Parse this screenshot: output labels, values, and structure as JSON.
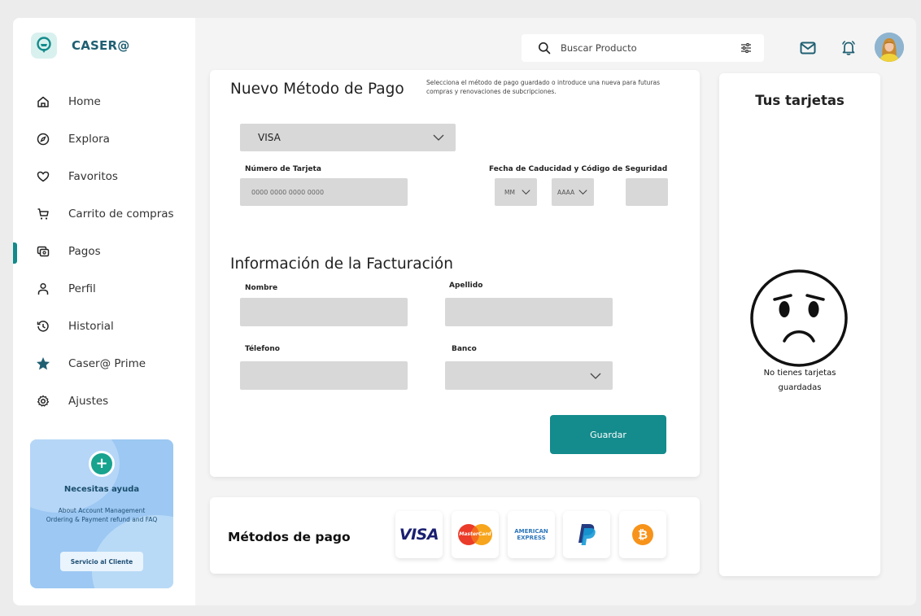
{
  "brand": {
    "name": "CASER@"
  },
  "nav": [
    {
      "label": "Home",
      "icon": "home-icon",
      "active": false
    },
    {
      "label": "Explora",
      "icon": "compass-icon",
      "active": false
    },
    {
      "label": "Favoritos",
      "icon": "heart-icon",
      "active": false
    },
    {
      "label": "Carrito de compras",
      "icon": "cart-icon",
      "active": false
    },
    {
      "label": "Pagos",
      "icon": "payments-icon",
      "active": true
    },
    {
      "label": "Perfil",
      "icon": "user-icon",
      "active": false
    },
    {
      "label": "Historial",
      "icon": "history-icon",
      "active": false
    },
    {
      "label": "Caser@ Prime",
      "icon": "star-icon",
      "active": false
    },
    {
      "label": "Ajustes",
      "icon": "gear-icon",
      "active": false
    }
  ],
  "help": {
    "title": "Necesitas ayuda",
    "text": "About Account Management Ordering & Payment refund and FAQ",
    "button": "Servicio al Cliente"
  },
  "search": {
    "placeholder": "Buscar Producto"
  },
  "payment": {
    "title": "Nuevo Método de Pago",
    "description": "Selecciona el método de pago guardado o introduce una nueva para futuras compras y renovaciones de subcripciones.",
    "card_type": "VISA",
    "card_number_label": "Número de Tarjeta",
    "card_number_placeholder": "0000 0000 0000 0000",
    "expiry_label": "Fecha de Caducidad y Código de Seguridad",
    "month": "MM",
    "year": "AAAA",
    "cvv": ""
  },
  "billing": {
    "title": "Información de la Facturación",
    "name_label": "Nombre",
    "surname_label": "Apellido",
    "phone_label": "Télefono",
    "bank_label": "Banco",
    "name": "",
    "surname": "",
    "phone": "",
    "bank": ""
  },
  "save_button": "Guardar",
  "methods": {
    "title": "Métodos de pago",
    "logos": [
      {
        "name": "visa",
        "text": "VISA"
      },
      {
        "name": "mastercard",
        "text": "MasterCard"
      },
      {
        "name": "amex",
        "text": "AMERICAN EXPRESS"
      },
      {
        "name": "paypal",
        "text": ""
      },
      {
        "name": "bitcoin",
        "text": ""
      }
    ]
  },
  "cards_panel": {
    "title": "Tus tarjetas",
    "empty_text": "No tienes tarjetas guardadas"
  },
  "colors": {
    "accent": "#148b8c",
    "brand_text": "#1f5f72",
    "help_bg": "#9cc8f3",
    "field_bg": "#d8d8d8"
  }
}
